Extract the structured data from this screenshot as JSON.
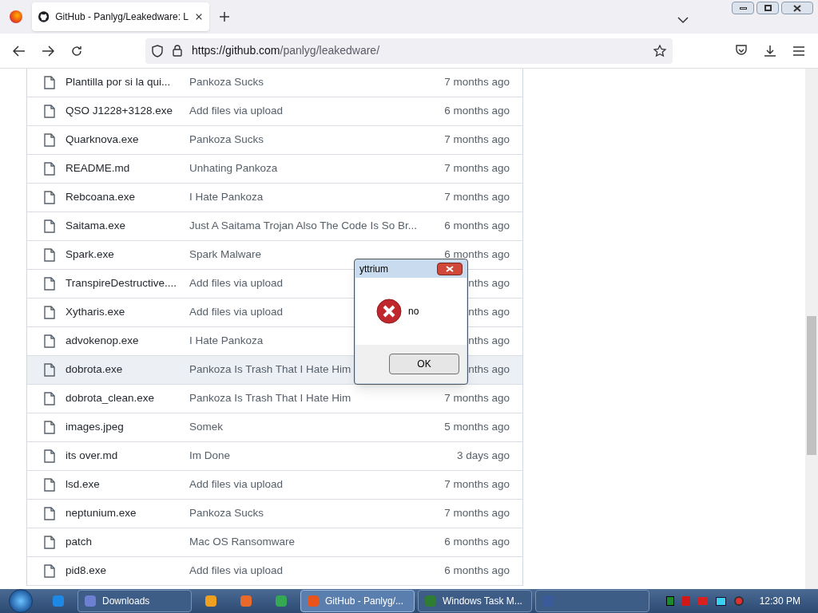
{
  "browser": {
    "tab_title": "GitHub - Panlyg/Leakedware: L",
    "url_host": "https://github.com",
    "url_path": "/panlyg/leakedware/"
  },
  "files": [
    {
      "name": "Plantilla por si la qui...",
      "message": "Pankoza Sucks",
      "date": "7 months ago",
      "hovered": false
    },
    {
      "name": "QSO J1228+3128.exe",
      "message": "Add files via upload",
      "date": "6 months ago",
      "hovered": false
    },
    {
      "name": "Quarknova.exe",
      "message": "Pankoza Sucks",
      "date": "7 months ago",
      "hovered": false
    },
    {
      "name": "README.md",
      "message": "Unhating Pankoza",
      "date": "7 months ago",
      "hovered": false
    },
    {
      "name": "Rebcoana.exe",
      "message": "I Hate Pankoza",
      "date": "7 months ago",
      "hovered": false
    },
    {
      "name": "Saitama.exe",
      "message": "Just A Saitama Trojan Also The Code Is So Br...",
      "date": "6 months ago",
      "hovered": false
    },
    {
      "name": "Spark.exe",
      "message": "Spark Malware",
      "date": "6 months ago",
      "hovered": false
    },
    {
      "name": "TranspireDestructive....",
      "message": "Add files via upload",
      "date": "nths ago",
      "hovered": false
    },
    {
      "name": "Xytharis.exe",
      "message": "Add files via upload",
      "date": "nths ago",
      "hovered": false
    },
    {
      "name": "advokenop.exe",
      "message": "I Hate Pankoza",
      "date": "nths ago",
      "hovered": false
    },
    {
      "name": "dobrota.exe",
      "message": "Pankoza Is Trash That I Hate Him",
      "date": "nths ago",
      "hovered": true
    },
    {
      "name": "dobrota_clean.exe",
      "message": "Pankoza Is Trash That I Hate Him",
      "date": "7 months ago",
      "hovered": false
    },
    {
      "name": "images.jpeg",
      "message": "Somek",
      "date": "5 months ago",
      "hovered": false
    },
    {
      "name": "its over.md",
      "message": "Im Done",
      "date": "3 days ago",
      "hovered": false
    },
    {
      "name": "lsd.exe",
      "message": "Add files via upload",
      "date": "7 months ago",
      "hovered": false
    },
    {
      "name": "neptunium.exe",
      "message": "Pankoza Sucks",
      "date": "7 months ago",
      "hovered": false
    },
    {
      "name": "patch",
      "message": "Mac OS Ransomware",
      "date": "6 months ago",
      "hovered": false
    },
    {
      "name": "pid8.exe",
      "message": "Add files via upload",
      "date": "6 months ago",
      "hovered": false
    }
  ],
  "dialog": {
    "title": "yttrium",
    "message": "no",
    "button": "OK"
  },
  "taskbar": {
    "items": [
      {
        "kind": "icon",
        "color": "#1e88e5"
      },
      {
        "kind": "button",
        "label": "Downloads",
        "color": "#6d7fd0",
        "selected": false
      },
      {
        "kind": "icon",
        "color": "#f0a020"
      },
      {
        "kind": "icon",
        "color": "#e86a2a"
      },
      {
        "kind": "icon",
        "color": "#34a853"
      },
      {
        "kind": "button",
        "label": "GitHub - Panlyg/...",
        "color": "#e8541a",
        "selected": true
      },
      {
        "kind": "button",
        "label": "Windows Task M...",
        "color": "#2e7d32",
        "selected": false
      },
      {
        "kind": "button",
        "color": "#3a5a9a",
        "selected": false
      }
    ],
    "clock": "12:30 PM"
  }
}
